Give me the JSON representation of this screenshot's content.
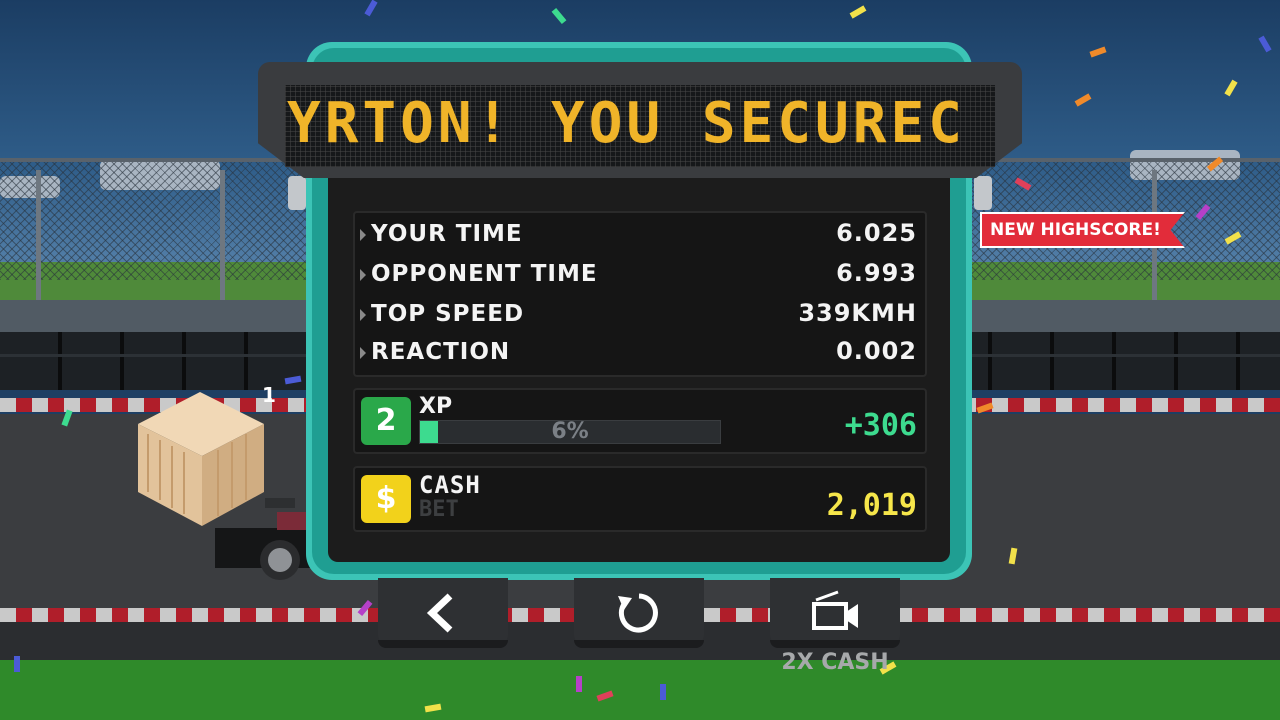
{
  "sign": {
    "marquee_text": "YRTON! YOU SECUREC"
  },
  "badges": {
    "highscore": "NEW HIGHSCORE!"
  },
  "race": {
    "lane_number": "1"
  },
  "stats": [
    {
      "label": "YOUR TIME",
      "value": "6.025"
    },
    {
      "label": "OPPONENT TIME",
      "value": "6.993"
    },
    {
      "label": "TOP SPEED",
      "value": "339KMH"
    },
    {
      "label": "REACTION",
      "value": "0.002"
    }
  ],
  "xp": {
    "level": "2",
    "label": "XP",
    "progress_text": "6%",
    "progress": 0.06,
    "gain": "+306"
  },
  "cash": {
    "symbol": "$",
    "label": "CASH",
    "sublabel": "BET",
    "amount": "2,019"
  },
  "buttons": {
    "ad_caption": "2X CASH"
  },
  "icons": [
    "back-arrow-icon",
    "restart-icon",
    "video-ad-icon"
  ],
  "colors": {
    "accent_teal": "#3cc4b6",
    "xp_green": "#3ddb8f",
    "cash_yellow": "#f6e64a",
    "sign_amber": "#f0b429",
    "badge_red": "#e22c3a"
  }
}
